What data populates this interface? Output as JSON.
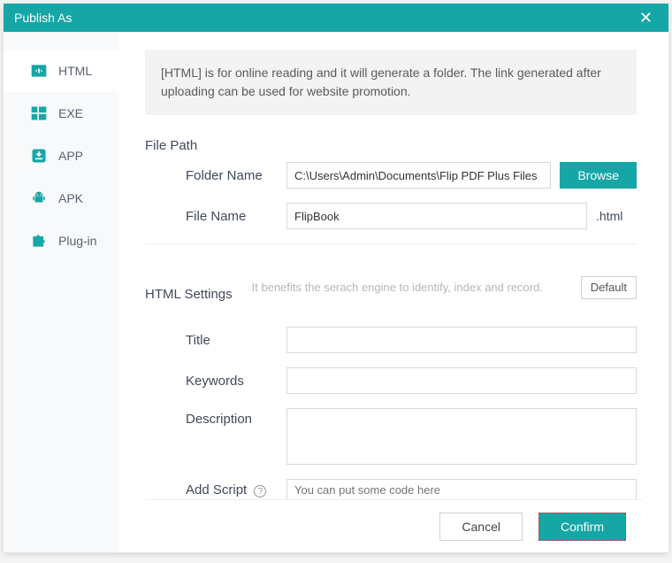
{
  "window": {
    "title": "Publish As"
  },
  "sidebar": {
    "items": [
      {
        "label": "HTML"
      },
      {
        "label": "EXE"
      },
      {
        "label": "APP"
      },
      {
        "label": "APK"
      },
      {
        "label": "Plug-in"
      }
    ]
  },
  "info": "[HTML] is for online reading and it will generate a folder. The link generated after uploading can be used for website promotion.",
  "filepath": {
    "section": "File Path",
    "folder_label": "Folder Name",
    "folder_value": "C:\\Users\\Admin\\Documents\\Flip PDF Plus Files",
    "browse": "Browse",
    "file_label": "File Name",
    "file_value": "FlipBook",
    "file_suffix": ".html"
  },
  "settings": {
    "section": "HTML Settings",
    "hint": "It benefits the serach engine to identify, index and record.",
    "default": "Default",
    "title_label": "Title",
    "title_value": "",
    "keywords_label": "Keywords",
    "keywords_value": "",
    "description_label": "Description",
    "description_value": "",
    "script_label": "Add Script",
    "script_placeholder": "You can put some code here",
    "script_value": ""
  },
  "footer": {
    "cancel": "Cancel",
    "confirm": "Confirm"
  }
}
